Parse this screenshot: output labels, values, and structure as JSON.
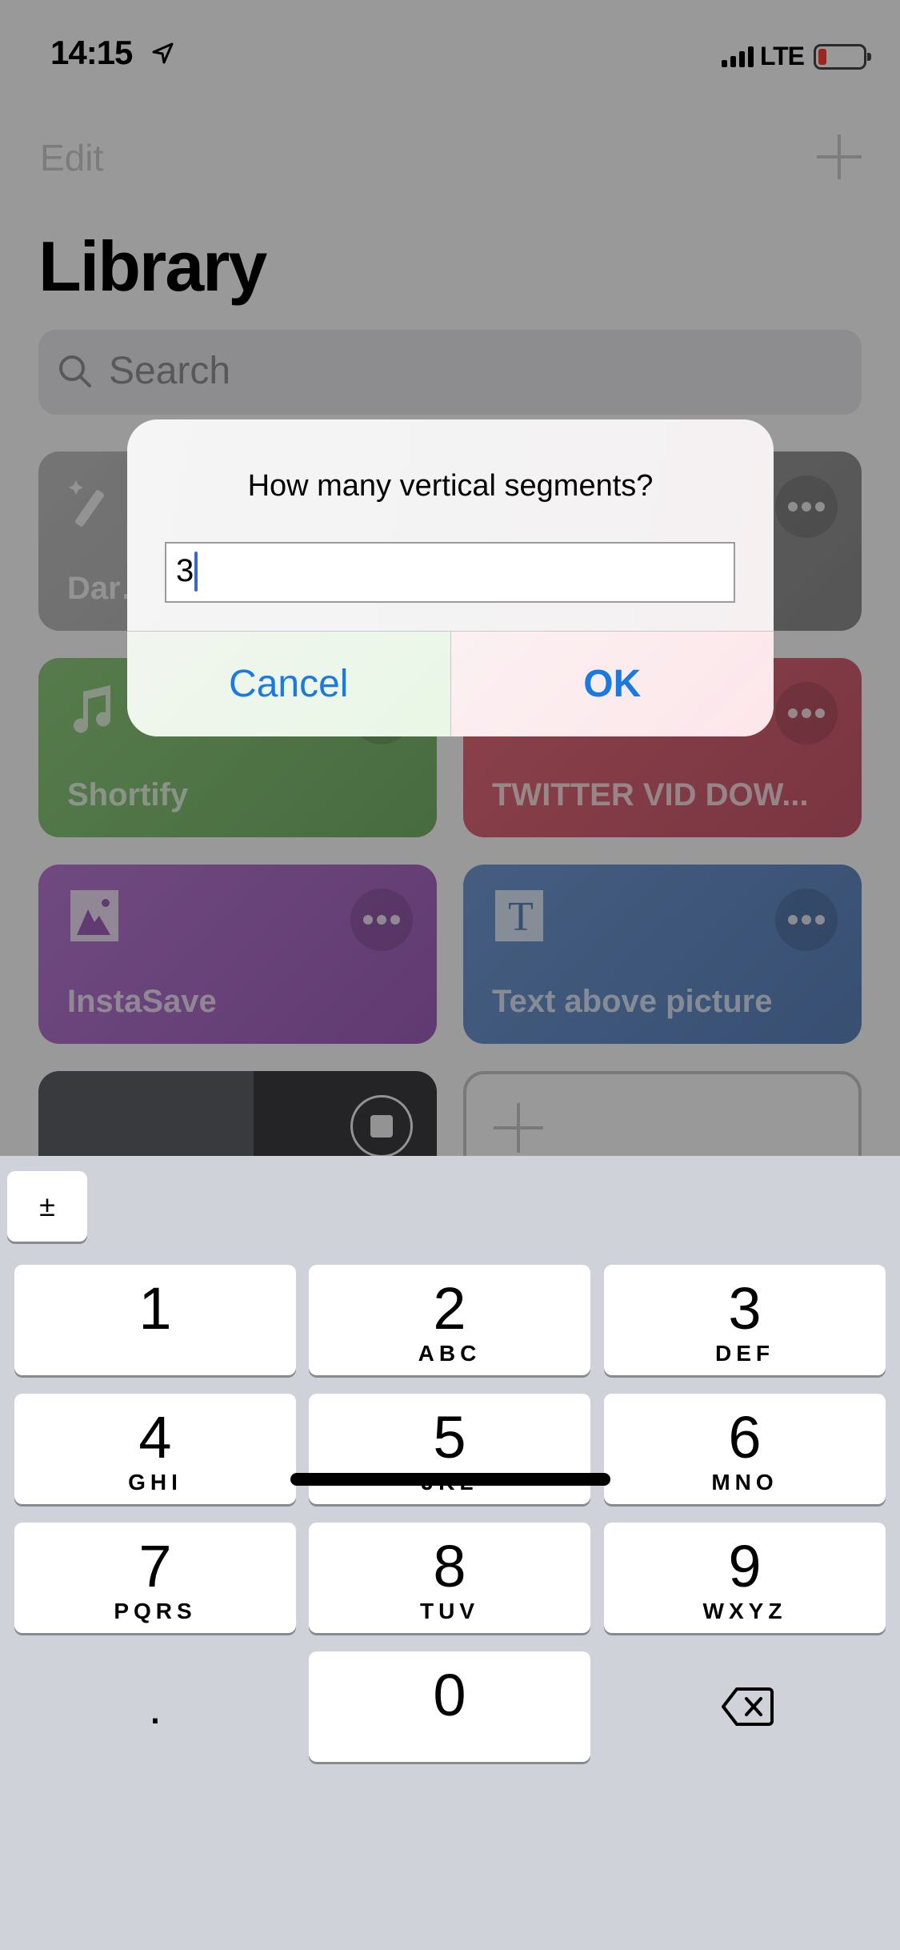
{
  "status_bar": {
    "time": "14:15",
    "network": "LTE",
    "battery_level": 0.1,
    "battery_color": "#ff3b30"
  },
  "nav": {
    "edit_label": "Edit",
    "add_icon": "plus-icon",
    "title": "Library"
  },
  "search": {
    "placeholder": "Search",
    "icon": "search-icon"
  },
  "shortcuts": [
    {
      "name": "Dar…",
      "icon": "magic-wand-icon",
      "color": "#bdbdbd"
    },
    {
      "name": "",
      "icon": "",
      "color": "#9c9c9c"
    },
    {
      "name": "Shortify",
      "icon": "music-note-icon",
      "color": "#8cc77a"
    },
    {
      "name": "TWITTER VID DOW...",
      "icon": "",
      "color": "#e06b79"
    },
    {
      "name": "InstaSave",
      "icon": "photo-icon",
      "color": "#b478cf"
    },
    {
      "name": "Text above picture",
      "icon": "text-icon",
      "color": "#6f97cf"
    },
    {
      "name": "",
      "icon": "stop-icon",
      "color": "#5c5e63"
    },
    {
      "name": "",
      "icon": "plus-icon",
      "color": "transparent"
    }
  ],
  "alert": {
    "title": "How many vertical segments?",
    "input_value": "3",
    "cancel_label": "Cancel",
    "ok_label": "OK",
    "accent": "#1a7ae0"
  },
  "keyboard": {
    "plus_minus": "±",
    "keys": [
      {
        "num": "1",
        "letters": ""
      },
      {
        "num": "2",
        "letters": "ABC"
      },
      {
        "num": "3",
        "letters": "DEF"
      },
      {
        "num": "4",
        "letters": "GHI"
      },
      {
        "num": "5",
        "letters": "JKL"
      },
      {
        "num": "6",
        "letters": "MNO"
      },
      {
        "num": "7",
        "letters": "PQRS"
      },
      {
        "num": "8",
        "letters": "TUV"
      },
      {
        "num": "9",
        "letters": "WXYZ"
      }
    ],
    "decimal": ".",
    "zero": "0",
    "delete_icon": "backspace-icon"
  }
}
